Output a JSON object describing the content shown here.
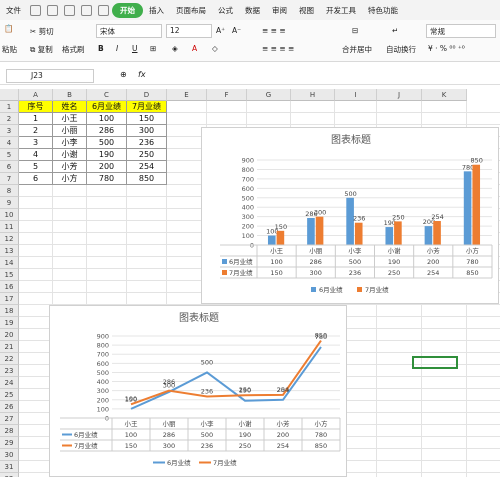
{
  "menubar": {
    "items": [
      "文件",
      "开始",
      "插入",
      "页面布局",
      "公式",
      "数据",
      "审阅",
      "视图",
      "开发工具",
      "特色功能"
    ],
    "active": "开始"
  },
  "ribbon": {
    "cut": "剪切",
    "paste": "粘贴",
    "copy": "复制",
    "format_painter": "格式刷",
    "font_name": "宋体",
    "font_size": "12",
    "merge_center": "合并居中",
    "wrap": "自动换行",
    "number_format": "常规",
    "bold": "B",
    "italic": "I",
    "underline": "U",
    "increase_font": "A⁺",
    "decrease_font": "A⁻"
  },
  "formula_bar": {
    "name_box": "J23",
    "fx": "fx"
  },
  "columns": [
    "A",
    "B",
    "C",
    "D",
    "E",
    "F",
    "G",
    "H",
    "I",
    "J",
    "K"
  ],
  "table": {
    "headers": [
      "序号",
      "姓名",
      "6月业绩",
      "7月业绩"
    ],
    "rows": [
      [
        "1",
        "小王",
        "100",
        "150"
      ],
      [
        "2",
        "小丽",
        "286",
        "300"
      ],
      [
        "3",
        "小李",
        "500",
        "236"
      ],
      [
        "4",
        "小谢",
        "190",
        "250"
      ],
      [
        "5",
        "小芳",
        "200",
        "254"
      ],
      [
        "6",
        "小方",
        "780",
        "850"
      ]
    ]
  },
  "chart_data": [
    {
      "type": "bar",
      "title": "图表标题",
      "categories": [
        "小王",
        "小丽",
        "小李",
        "小谢",
        "小芳",
        "小方"
      ],
      "series": [
        {
          "name": "6月业绩",
          "values": [
            100,
            286,
            500,
            190,
            200,
            780
          ],
          "color": "#5b9bd5"
        },
        {
          "name": "7月业绩",
          "values": [
            150,
            300,
            236,
            250,
            254,
            850
          ],
          "color": "#ed7d31"
        }
      ],
      "ylim": [
        0,
        900
      ],
      "yticks": [
        "0",
        "100",
        "200",
        "300",
        "400",
        "500",
        "600",
        "700",
        "800",
        "900"
      ],
      "data_table": true,
      "legend": "bottom"
    },
    {
      "type": "line",
      "title": "图表标题",
      "categories": [
        "小王",
        "小丽",
        "小李",
        "小谢",
        "小芳",
        "小方"
      ],
      "series": [
        {
          "name": "6月业绩",
          "values": [
            100,
            286,
            500,
            190,
            200,
            780
          ],
          "color": "#5b9bd5"
        },
        {
          "name": "7月业绩",
          "values": [
            150,
            300,
            236,
            250,
            254,
            850
          ],
          "color": "#ed7d31"
        }
      ],
      "ylim": [
        0,
        900
      ],
      "yticks": [
        "0",
        "100",
        "200",
        "300",
        "400",
        "500",
        "600",
        "700",
        "800",
        "900"
      ],
      "data_table": true,
      "legend": "bottom"
    }
  ]
}
